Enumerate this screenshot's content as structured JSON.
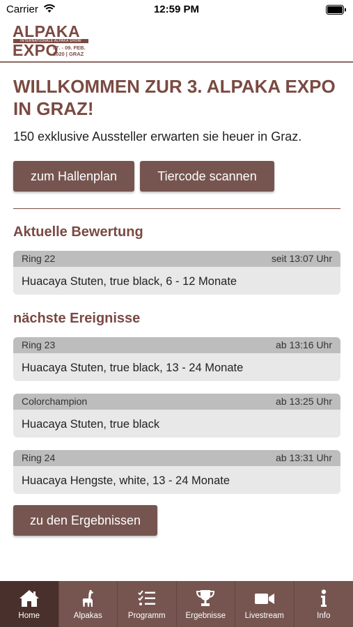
{
  "status_bar": {
    "carrier": "Carrier",
    "time": "12:59 PM"
  },
  "logo": {
    "line1": "ALPAKA",
    "subtitle": "INTERNATIONALE ALPAKA SHOW",
    "line2": "EXPO",
    "dates_line1": "07. - 09. FEB.",
    "dates_line2": "2020 | GRAZ"
  },
  "main": {
    "title": "WILLKOMMEN ZUR 3. ALPAKA EXPO IN GRAZ!",
    "intro": "150 exklusive Aussteller erwarten sie heuer in Graz.",
    "hallenplan_button": "zum Hallenplan",
    "scan_button": "Tiercode scannen",
    "current_section": "Aktuelle Bewertung",
    "next_section": "nächste Ereignisse",
    "results_button": "zu den Ergebnissen"
  },
  "current_event": {
    "ring": "Ring 22",
    "time": "seit 13:07 Uhr",
    "description": "Huacaya Stuten, true black, 6 - 12 Monate"
  },
  "next_events": [
    {
      "ring": "Ring 23",
      "time": "ab 13:16 Uhr",
      "description": "Huacaya Stuten, true black, 13 - 24 Monate"
    },
    {
      "ring": "Colorchampion",
      "time": "ab 13:25 Uhr",
      "description": "Huacaya Stuten, true black"
    },
    {
      "ring": "Ring 24",
      "time": "ab 13:31 Uhr",
      "description": "Huacaya Hengste, white, 13 - 24 Monate"
    }
  ],
  "tab_bar": {
    "items": [
      {
        "label": "Home",
        "icon": "home-icon",
        "active": true
      },
      {
        "label": "Alpakas",
        "icon": "alpaca-icon"
      },
      {
        "label": "Programm",
        "icon": "checklist-icon"
      },
      {
        "label": "Ergebnisse",
        "icon": "trophy-icon"
      },
      {
        "label": "Livestream",
        "icon": "video-camera-icon"
      },
      {
        "label": "Info",
        "icon": "info-icon"
      }
    ]
  },
  "colors": {
    "brand": "#7a4a42",
    "button": "#765550",
    "tab_active": "#4a302c",
    "card_header": "#bdbdbd",
    "card_body": "#e8e8e8"
  }
}
